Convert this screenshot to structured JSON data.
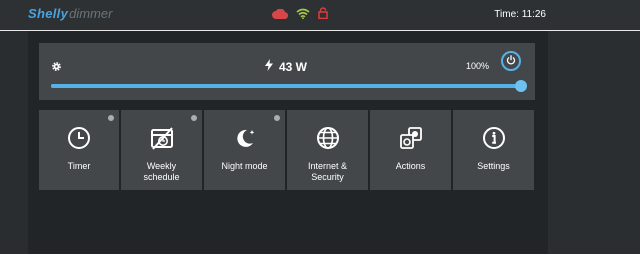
{
  "header": {
    "brand": "Shelly",
    "product": "dimmer",
    "time_label": "Time: 11:26",
    "status_icons": [
      "cloud-icon",
      "wifi-icon",
      "lock-icon"
    ],
    "colors": {
      "cloud": "#d9464a",
      "wifi": "#a6c94a",
      "lock": "#e23b3b",
      "brand": "#4aa3df"
    }
  },
  "control": {
    "power_value": "43 W",
    "brightness_label": "100%",
    "brightness": 1.0,
    "accent": "#56b1e8"
  },
  "tiles": [
    {
      "label": "Timer",
      "icon": "clock-icon",
      "indicator": true
    },
    {
      "label": "Weekly\nschedule",
      "icon": "calendar-off-icon",
      "indicator": true
    },
    {
      "label": "Night mode",
      "icon": "moon-icon",
      "indicator": true
    },
    {
      "label": "Internet &\nSecurity",
      "icon": "globe-icon",
      "indicator": false
    },
    {
      "label": "Actions",
      "icon": "actions-icon",
      "indicator": false
    },
    {
      "label": "Settings",
      "icon": "info-icon",
      "indicator": false
    }
  ]
}
